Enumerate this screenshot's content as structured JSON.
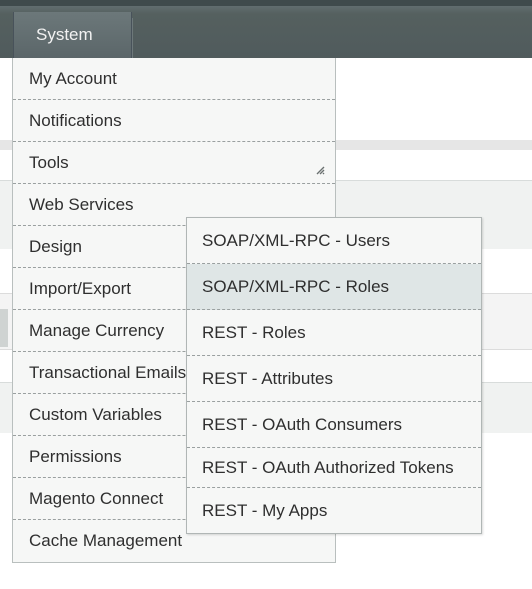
{
  "topbar": {
    "active_label": "System"
  },
  "menu": {
    "items": [
      "My Account",
      "Notifications",
      "Tools",
      "Web Services",
      "Design",
      "Import/Export",
      "Manage Currency",
      "Transactional Emails",
      "Custom Variables",
      "Permissions",
      "Magento Connect",
      "Cache Management"
    ]
  },
  "submenu": {
    "items": [
      "SOAP/XML-RPC - Users",
      "SOAP/XML-RPC - Roles",
      "REST - Roles",
      "REST - Attributes",
      "REST - OAuth Consumers",
      "REST - OAuth Authorized Tokens",
      "REST - My Apps"
    ],
    "hovered": "SOAP/XML-RPC - Roles"
  },
  "icons": {
    "resize": "resize-grip-icon"
  },
  "colors": {
    "topbar": "#55605f",
    "menu_bg": "#f6f7f6",
    "hover_bg": "#dfe6e6"
  }
}
